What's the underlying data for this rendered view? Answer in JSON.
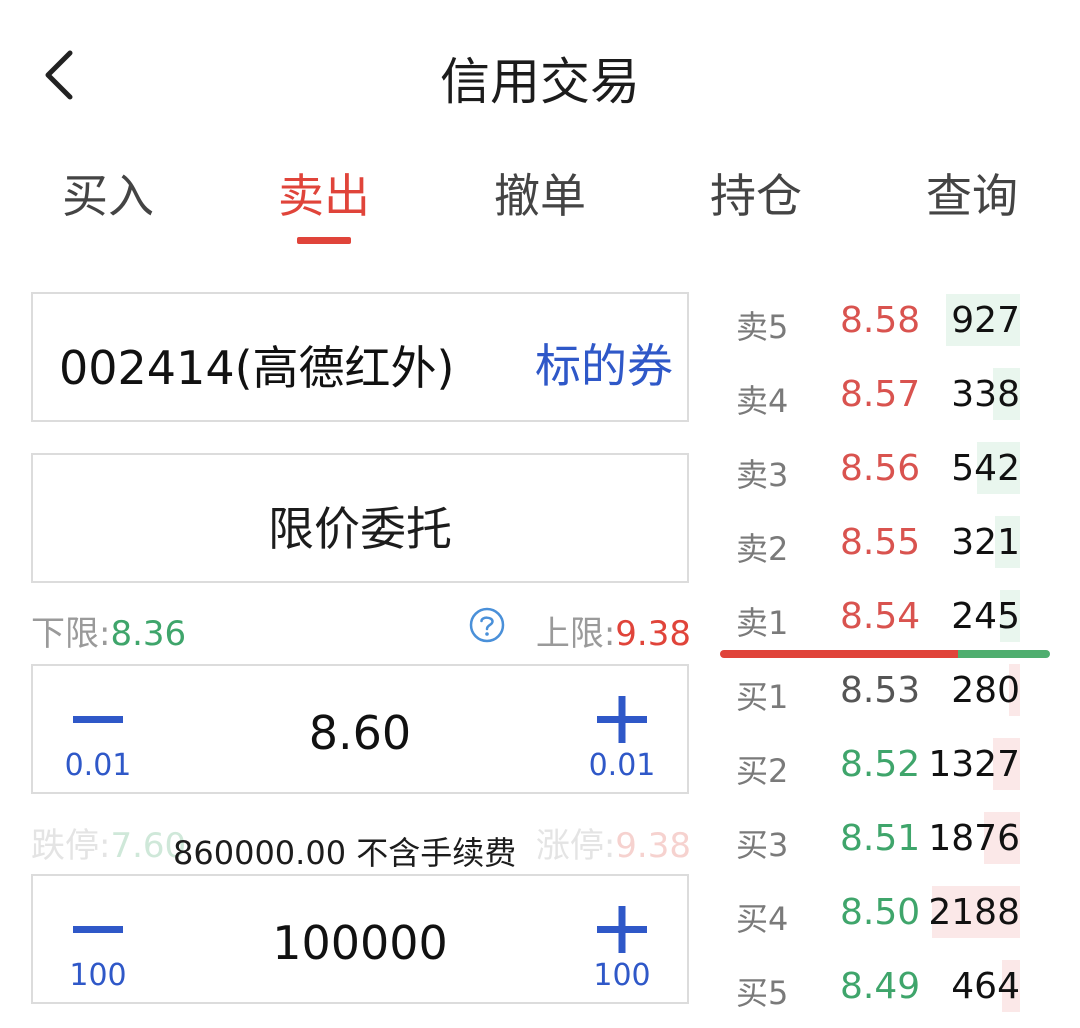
{
  "header": {
    "title": "信用交易"
  },
  "tabs": [
    {
      "label": "买入",
      "active": false
    },
    {
      "label": "卖出",
      "active": true
    },
    {
      "label": "撤单",
      "active": false
    },
    {
      "label": "持仓",
      "active": false
    },
    {
      "label": "查询",
      "active": false
    }
  ],
  "stock": {
    "code_name": "002414(高德红外)",
    "tag": "标的券"
  },
  "order_type": "限价委托",
  "limits": {
    "lower_label": "下限:",
    "lower_value": "8.36",
    "upper_label": "上限:",
    "upper_value": "9.38"
  },
  "price_stepper": {
    "minus_step": "0.01",
    "value": "8.60",
    "plus_step": "0.01"
  },
  "stops": {
    "low_label": "跌停:",
    "low_value": "7.60",
    "high_label": "涨停:",
    "high_value": "9.38"
  },
  "amount_note": "860000.00 不含手续费",
  "qty_stepper": {
    "minus_step": "100",
    "value": "100000",
    "plus_step": "100"
  },
  "order_book": {
    "asks": [
      {
        "label": "卖5",
        "price": "8.58",
        "volume": "927",
        "depth": 0.82
      },
      {
        "label": "卖4",
        "price": "8.57",
        "volume": "338",
        "depth": 0.3
      },
      {
        "label": "卖3",
        "price": "8.56",
        "volume": "542",
        "depth": 0.48
      },
      {
        "label": "卖2",
        "price": "8.55",
        "volume": "321",
        "depth": 0.28
      },
      {
        "label": "卖1",
        "price": "8.54",
        "volume": "245",
        "depth": 0.22
      }
    ],
    "bids": [
      {
        "label": "买1",
        "price": "8.53",
        "volume": "280",
        "depth": 0.12,
        "tone": "gray"
      },
      {
        "label": "买2",
        "price": "8.52",
        "volume": "1327",
        "depth": 0.3,
        "tone": "green"
      },
      {
        "label": "买3",
        "price": "8.51",
        "volume": "1876",
        "depth": 0.4,
        "tone": "green"
      },
      {
        "label": "买4",
        "price": "8.50",
        "volume": "2188",
        "depth": 0.98,
        "tone": "green"
      },
      {
        "label": "买5",
        "price": "8.49",
        "volume": "464",
        "depth": 0.2,
        "tone": "green"
      }
    ],
    "bid_ask_ratio": 0.72
  },
  "colors": {
    "accent_red": "#e0443a",
    "link_blue": "#2f58c8",
    "up_green": "#3fa56b"
  }
}
